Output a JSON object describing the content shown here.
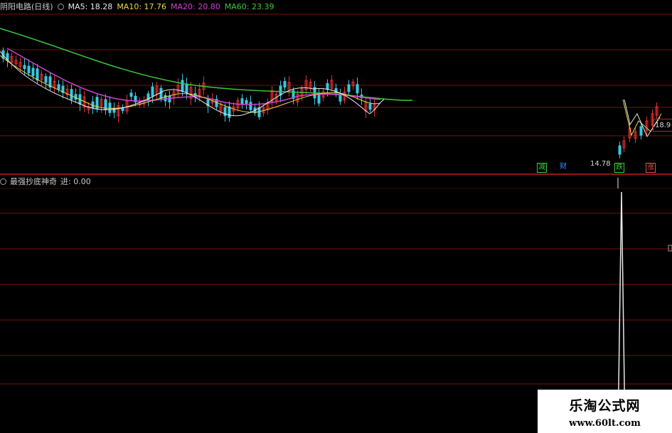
{
  "header": {
    "stock_title": "阴阳电路(日线)",
    "indicators": [
      {
        "label": "MA5: 18.28",
        "color": "#e8e8e8"
      },
      {
        "label": "MA10: 17.76",
        "color": "#e8d84a"
      },
      {
        "label": "MA20: 20.80",
        "color": "#d040d0"
      },
      {
        "label": "MA60: 23.39",
        "color": "#3cc83c"
      }
    ]
  },
  "sub_header": {
    "indicator_name": "最强抄底神奇",
    "value_label": "进: 0.00"
  },
  "markers": {
    "low_price": "14.78",
    "price_box": "18.9",
    "tags": [
      {
        "text": "减",
        "color": "#3cc83c"
      },
      {
        "text": "财",
        "color": "#3c8cff"
      },
      {
        "text": "跌",
        "color": "#3cc83c"
      },
      {
        "text": "涨",
        "color": "#e05050"
      }
    ]
  },
  "watermark": {
    "name": "乐淘公式网",
    "url": "www.60lt.com"
  },
  "colors": {
    "up": "#e03030",
    "down": "#38c8e0",
    "grid": "#7a1010",
    "divider": "#c02020"
  }
}
